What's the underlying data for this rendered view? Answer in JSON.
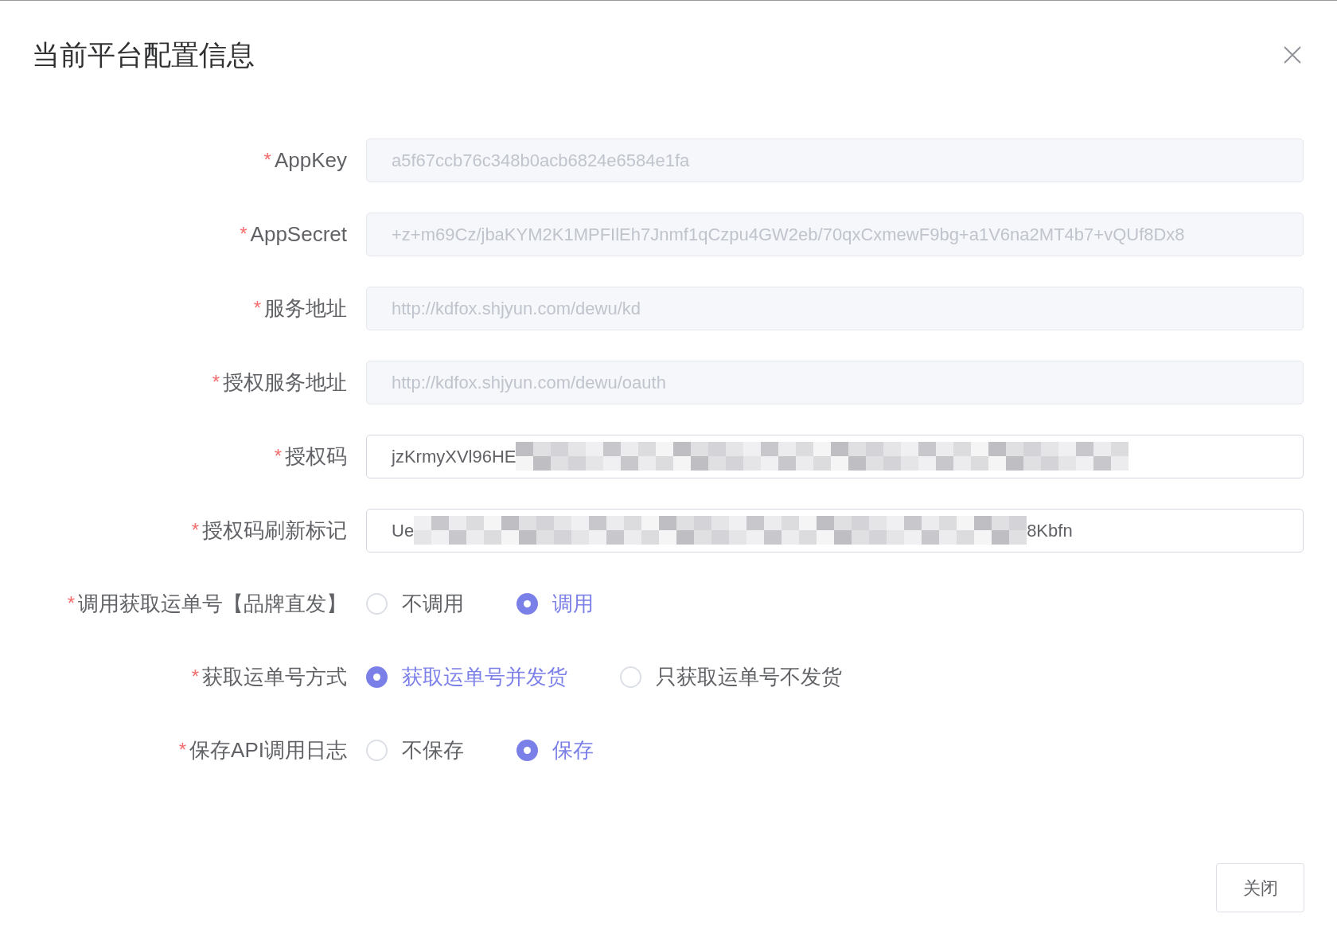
{
  "dialog": {
    "title": "当前平台配置信息"
  },
  "fields": [
    {
      "required_mark": "*",
      "label": "AppKey",
      "disabled": true,
      "value": "a5f67ccb76c348b0acb6824e6584e1fa"
    },
    {
      "required_mark": "*",
      "label": "AppSecret",
      "disabled": true,
      "value": "+z+m69Cz/jbaKYM2K1MPFIlEh7Jnmf1qCzpu4GW2eb/70qxCxmewF9bg+a1V6na2MT4b7+vQUf8Dx8"
    },
    {
      "required_mark": "*",
      "label": "服务地址",
      "disabled": true,
      "value": "http://kdfox.shjyun.com/dewu/kd"
    },
    {
      "required_mark": "*",
      "label": "授权服务地址",
      "disabled": true,
      "value": "http://kdfox.shjyun.com/dewu/oauth"
    },
    {
      "required_mark": "*",
      "label": "授权码",
      "disabled": false,
      "value": "jzKrmyXVl96HE",
      "redacted": true
    },
    {
      "required_mark": "*",
      "label": "授权码刷新标记",
      "disabled": false,
      "value": "Ue",
      "value_end": "8Kbfn",
      "redacted": true
    }
  ],
  "radio_groups": [
    {
      "required_mark": "*",
      "label": "调用获取运单号【品牌直发】",
      "options": [
        {
          "label": "不调用",
          "selected": false
        },
        {
          "label": "调用",
          "selected": true
        }
      ]
    },
    {
      "required_mark": "*",
      "label": "获取运单号方式",
      "options": [
        {
          "label": "获取运单号并发货",
          "selected": true
        },
        {
          "label": "只获取运单号不发货",
          "selected": false
        }
      ]
    },
    {
      "required_mark": "*",
      "label": "保存API调用日志",
      "options": [
        {
          "label": "不保存",
          "selected": false
        },
        {
          "label": "保存",
          "selected": true
        }
      ]
    }
  ],
  "buttons": [
    {
      "label": "关闭"
    }
  ]
}
